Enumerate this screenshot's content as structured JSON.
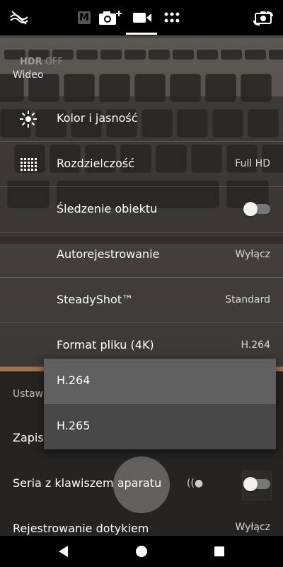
{
  "topbar": {
    "icons": [
      "flash-off-icon",
      "manual-mode-icon",
      "photo-plus-icon",
      "video-icon",
      "apps-grid-icon",
      "switch-camera-icon"
    ],
    "manual_label": "M",
    "active_mode": "video"
  },
  "overlay": {
    "hdr_label": "HDR",
    "hdr_state": "OFF",
    "mode_label": "Wideo"
  },
  "settings": {
    "items": [
      {
        "label": "Kolor i jasność",
        "value": "",
        "icon": "brightness-icon"
      },
      {
        "label": "Rozdzielczość",
        "value": "Full HD",
        "icon": "resolution-grid-icon"
      },
      {
        "label": "Śledzenie obiektu",
        "value": "",
        "toggle": false
      },
      {
        "label": "Autorejestrowanie",
        "value": "Wyłącz"
      },
      {
        "label": "SteadyShot™",
        "value": "Standard"
      },
      {
        "label": "Format pliku (4K)",
        "value": "H.264"
      }
    ]
  },
  "lower": {
    "section_header": "Ustaw",
    "row_zapis": "Zapis",
    "row_seria": "Seria z klawiszem aparatu",
    "row_seria_toggle": false,
    "row_rejestrowanie": "Rejestrowanie dotykiem",
    "row_rejestrowanie_value": "Wyłącz"
  },
  "dropdown": {
    "options": [
      "H.264",
      "H.265"
    ],
    "selected": "H.264"
  },
  "navbar": {
    "icons": [
      "back-icon",
      "home-icon",
      "recents-icon"
    ]
  },
  "colors": {
    "topbar_bg": "#000000",
    "dropdown_selected": "#5f5f5f",
    "dropdown_option": "#484848",
    "toggle_track": "#777777"
  }
}
